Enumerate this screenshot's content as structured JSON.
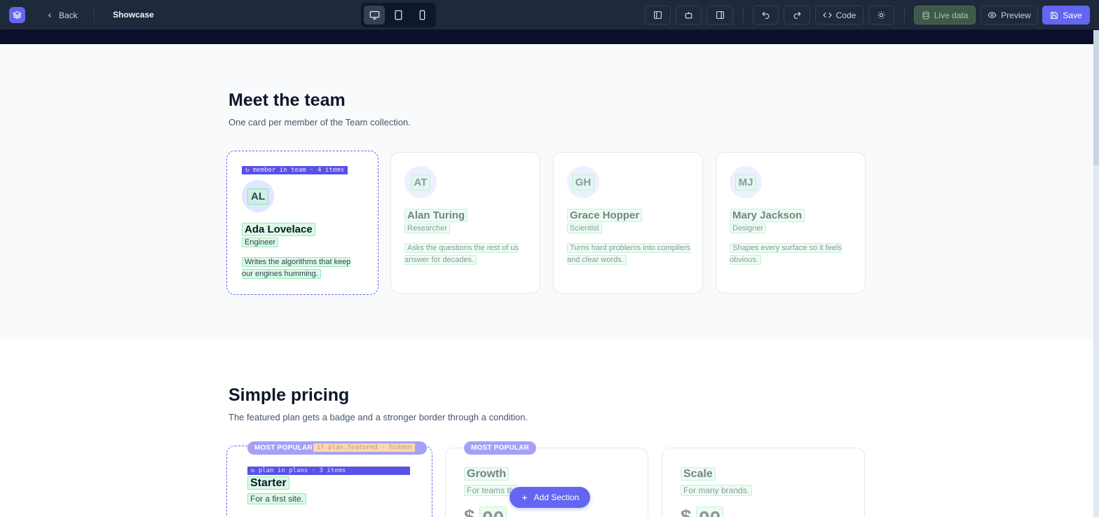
{
  "toolbar": {
    "back_label": "Back",
    "title": "Showcase",
    "code_label": "Code",
    "live_data_label": "Live data",
    "preview_label": "Preview",
    "save_label": "Save",
    "device_active": "desktop"
  },
  "team": {
    "heading": "Meet the team",
    "subheading": "One card per member of the Team collection.",
    "loop_tag": "↻ member in team · 4 items",
    "members": [
      {
        "initials": "AL",
        "name": "Ada Lovelace",
        "role": "Engineer",
        "bio": "Writes the algorithms that keep our engines humming."
      },
      {
        "initials": "AT",
        "name": "Alan Turing",
        "role": "Researcher",
        "bio": "Asks the questions the rest of us answer for decades."
      },
      {
        "initials": "GH",
        "name": "Grace Hopper",
        "role": "Scientist",
        "bio": "Turns hard problems into compilers and clear words."
      },
      {
        "initials": "MJ",
        "name": "Mary Jackson",
        "role": "Designer",
        "bio": "Shapes every surface so it feels obvious."
      }
    ]
  },
  "pricing": {
    "heading": "Simple pricing",
    "subheading": "The featured plan gets a badge and a stronger border through a condition.",
    "badge_label": "MOST POPULAR",
    "condition_tag": "if plan.featured · hidden",
    "loop_tag": "↻ plan in plans · 3 items",
    "plans": [
      {
        "name": "Starter",
        "desc": "For a first site."
      },
      {
        "name": "Growth",
        "desc": "For teams th"
      },
      {
        "name": "Scale",
        "desc": "For many brands."
      }
    ]
  },
  "add_section_label": "Add Section",
  "colors": {
    "accent": "#6366f1",
    "toolbar_bg": "#1e293b",
    "highlight": "#bbf7d0"
  }
}
